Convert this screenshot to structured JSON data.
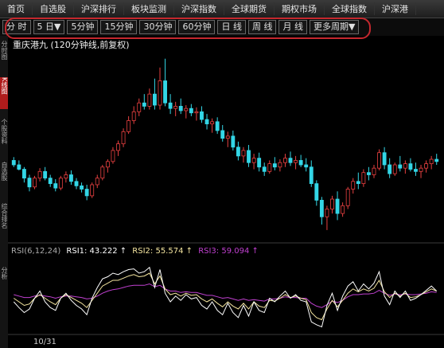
{
  "topnav": {
    "tabs": [
      "首页",
      "自选股",
      "沪深排行",
      "板块监测",
      "沪深指数",
      "全球期货",
      "期权市场",
      "全球指数",
      "沪深港"
    ]
  },
  "periods": {
    "buttons": [
      "分 时",
      "5 日▼",
      "5分钟",
      "15分钟",
      "30分钟",
      "60分钟",
      "日 线",
      "周 线",
      "月 线",
      "更多周期▼"
    ]
  },
  "leftrail": {
    "tabs": [
      "分时图",
      "K线图",
      "个股资料",
      "自选股",
      "综合排名",
      "分析"
    ]
  },
  "chart": {
    "title": "重庆港九 (120分钟线,前复权)",
    "date_label": "10/31"
  },
  "rsi": {
    "label": "RSI(6,12,24)",
    "rsi1": "RSI1: 43.222 ↑",
    "rsi2": "RSI2: 55.574 ↑",
    "rsi3": "RSI3: 59.094 ↑",
    "colors": {
      "rsi1": "#ffffff",
      "rsi2": "#f5e6a0",
      "rsi3": "#c040d0"
    }
  },
  "colors": {
    "up": "#e84040",
    "down": "#33d6e6",
    "highlight": "#c4282e"
  },
  "chart_data": {
    "type": "candlestick",
    "candles": [
      [
        6.46,
        6.49,
        6.4,
        6.42
      ],
      [
        6.42,
        6.46,
        6.37,
        6.38
      ],
      [
        6.38,
        6.4,
        6.26,
        6.3
      ],
      [
        6.3,
        6.33,
        6.18,
        6.22
      ],
      [
        6.22,
        6.32,
        6.2,
        6.3
      ],
      [
        6.3,
        6.39,
        6.27,
        6.36
      ],
      [
        6.36,
        6.4,
        6.28,
        6.3
      ],
      [
        6.3,
        6.33,
        6.22,
        6.25
      ],
      [
        6.25,
        6.29,
        6.18,
        6.21
      ],
      [
        6.21,
        6.32,
        6.19,
        6.3
      ],
      [
        6.3,
        6.36,
        6.26,
        6.33
      ],
      [
        6.33,
        6.37,
        6.24,
        6.27
      ],
      [
        6.27,
        6.3,
        6.2,
        6.23
      ],
      [
        6.23,
        6.26,
        6.17,
        6.2
      ],
      [
        6.2,
        6.24,
        6.1,
        6.14
      ],
      [
        6.14,
        6.26,
        6.12,
        6.24
      ],
      [
        6.24,
        6.33,
        6.21,
        6.3
      ],
      [
        6.3,
        6.42,
        6.28,
        6.4
      ],
      [
        6.4,
        6.47,
        6.35,
        6.45
      ],
      [
        6.45,
        6.58,
        6.43,
        6.55
      ],
      [
        6.55,
        6.64,
        6.5,
        6.61
      ],
      [
        6.61,
        6.75,
        6.58,
        6.72
      ],
      [
        6.72,
        6.86,
        6.7,
        6.82
      ],
      [
        6.82,
        6.95,
        6.79,
        6.9
      ],
      [
        6.9,
        7.02,
        6.86,
        6.98
      ],
      [
        6.98,
        7.06,
        6.92,
        6.95
      ],
      [
        6.95,
        7.11,
        6.92,
        7.06
      ],
      [
        7.06,
        7.2,
        6.92,
        6.96
      ],
      [
        6.96,
        7.3,
        6.92,
        7.18
      ],
      [
        7.18,
        7.38,
        6.95,
        6.98
      ],
      [
        6.98,
        7.06,
        6.88,
        6.93
      ],
      [
        6.93,
        6.99,
        6.86,
        6.95
      ],
      [
        6.95,
        7.02,
        6.88,
        6.91
      ],
      [
        6.91,
        6.96,
        6.84,
        6.93
      ],
      [
        6.93,
        6.97,
        6.86,
        6.89
      ],
      [
        6.89,
        6.94,
        6.82,
        6.9
      ],
      [
        6.9,
        6.95,
        6.8,
        6.83
      ],
      [
        6.83,
        6.88,
        6.74,
        6.79
      ],
      [
        6.79,
        6.84,
        6.71,
        6.81
      ],
      [
        6.81,
        6.85,
        6.7,
        6.73
      ],
      [
        6.73,
        6.78,
        6.63,
        6.66
      ],
      [
        6.66,
        6.72,
        6.58,
        6.68
      ],
      [
        6.68,
        6.73,
        6.55,
        6.58
      ],
      [
        6.58,
        6.63,
        6.46,
        6.5
      ],
      [
        6.5,
        6.58,
        6.44,
        6.55
      ],
      [
        6.55,
        6.6,
        6.4,
        6.44
      ],
      [
        6.44,
        6.52,
        6.38,
        6.48
      ],
      [
        6.48,
        6.53,
        6.36,
        6.4
      ],
      [
        6.4,
        6.44,
        6.32,
        6.36
      ],
      [
        6.36,
        6.46,
        6.34,
        6.43
      ],
      [
        6.43,
        6.49,
        6.37,
        6.4
      ],
      [
        6.4,
        6.47,
        6.36,
        6.44
      ],
      [
        6.44,
        6.52,
        6.4,
        6.48
      ],
      [
        6.48,
        6.54,
        6.41,
        6.44
      ],
      [
        6.44,
        6.5,
        6.38,
        6.46
      ],
      [
        6.46,
        6.51,
        6.4,
        6.42
      ],
      [
        6.42,
        6.48,
        6.36,
        6.4
      ],
      [
        6.4,
        6.46,
        6.22,
        6.25
      ],
      [
        6.25,
        6.28,
        6.05,
        6.1
      ],
      [
        6.1,
        6.13,
        5.88,
        5.95
      ],
      [
        5.95,
        6.05,
        5.83,
        6.02
      ],
      [
        6.02,
        6.14,
        5.98,
        6.11
      ],
      [
        6.11,
        6.18,
        5.92,
        5.98
      ],
      [
        5.98,
        6.08,
        5.95,
        6.05
      ],
      [
        6.05,
        6.22,
        6.02,
        6.2
      ],
      [
        6.2,
        6.3,
        6.16,
        6.27
      ],
      [
        6.27,
        6.35,
        6.2,
        6.25
      ],
      [
        6.25,
        6.38,
        6.22,
        6.35
      ],
      [
        6.35,
        6.4,
        6.28,
        6.33
      ],
      [
        6.33,
        6.42,
        6.3,
        6.39
      ],
      [
        6.39,
        6.56,
        6.37,
        6.53
      ],
      [
        6.53,
        6.58,
        6.38,
        6.42
      ],
      [
        6.42,
        6.48,
        6.3,
        6.34
      ],
      [
        6.34,
        6.44,
        6.32,
        6.42
      ],
      [
        6.42,
        6.5,
        6.36,
        6.39
      ],
      [
        6.39,
        6.46,
        6.34,
        6.43
      ],
      [
        6.43,
        6.48,
        6.36,
        6.38
      ],
      [
        6.38,
        6.44,
        6.32,
        6.36
      ],
      [
        6.36,
        6.42,
        6.3,
        6.39
      ],
      [
        6.39,
        6.46,
        6.35,
        6.43
      ],
      [
        6.43,
        6.5,
        6.38,
        6.47
      ],
      [
        6.47,
        6.52,
        6.42,
        6.45
      ]
    ],
    "ylim": [
      5.75,
      7.45
    ],
    "rsi_ylim": [
      0,
      100
    ],
    "rsi1": [
      40,
      32,
      25,
      30,
      45,
      55,
      40,
      32,
      28,
      45,
      52,
      42,
      35,
      30,
      22,
      45,
      60,
      72,
      75,
      80,
      78,
      82,
      85,
      86,
      80,
      82,
      88,
      60,
      85,
      52,
      40,
      48,
      42,
      50,
      44,
      46,
      35,
      30,
      40,
      28,
      22,
      38,
      25,
      18,
      35,
      20,
      40,
      28,
      25,
      45,
      40,
      48,
      55,
      45,
      50,
      42,
      40,
      12,
      8,
      5,
      35,
      52,
      28,
      48,
      62,
      68,
      55,
      65,
      58,
      66,
      82,
      48,
      36,
      55,
      46,
      55,
      42,
      45,
      50,
      56,
      62,
      55
    ],
    "rsi2": [
      45,
      40,
      35,
      37,
      45,
      50,
      45,
      40,
      36,
      45,
      50,
      46,
      42,
      38,
      32,
      42,
      52,
      62,
      66,
      70,
      70,
      73,
      76,
      78,
      75,
      76,
      80,
      65,
      76,
      58,
      50,
      52,
      48,
      52,
      49,
      50,
      44,
      40,
      44,
      38,
      33,
      40,
      34,
      30,
      38,
      30,
      40,
      34,
      32,
      42,
      41,
      45,
      50,
      46,
      48,
      45,
      43,
      25,
      18,
      15,
      30,
      42,
      33,
      42,
      52,
      58,
      54,
      58,
      55,
      59,
      70,
      54,
      46,
      52,
      48,
      52,
      46,
      47,
      50,
      54,
      58,
      55
    ],
    "rsi3": [
      50,
      48,
      46,
      46,
      48,
      49,
      48,
      47,
      45,
      47,
      48,
      48,
      47,
      46,
      44,
      45,
      48,
      52,
      55,
      57,
      58,
      60,
      62,
      63,
      63,
      63,
      65,
      61,
      63,
      58,
      55,
      55,
      53,
      54,
      53,
      53,
      51,
      49,
      49,
      47,
      45,
      46,
      44,
      42,
      44,
      42,
      43,
      42,
      41,
      44,
      44,
      45,
      47,
      46,
      46,
      45,
      45,
      38,
      34,
      32,
      36,
      41,
      39,
      42,
      47,
      50,
      50,
      51,
      51,
      52,
      56,
      52,
      49,
      51,
      50,
      51,
      50,
      50,
      51,
      52,
      54,
      53
    ]
  }
}
